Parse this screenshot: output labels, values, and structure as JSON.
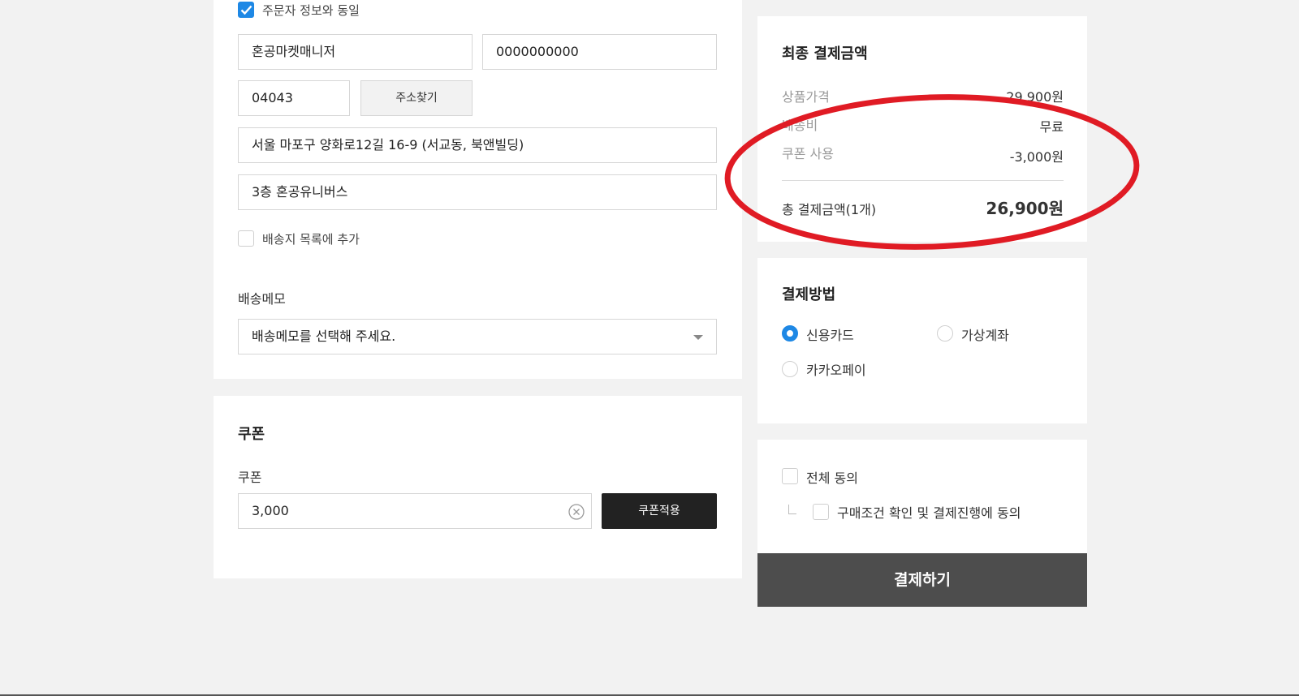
{
  "shipping": {
    "same_as_orderer_label": "주문자 정보와 동일",
    "name_value": "혼공마켓매니저",
    "phone_value": "0000000000",
    "postcode_value": "04043",
    "find_address_button": "주소찾기",
    "address_value": "서울 마포구 양화로12길 16-9 (서교동, 북앤빌딩)",
    "address_detail_value": "3층 혼공유니버스",
    "add_to_list_label": "배송지 목록에 추가",
    "memo_title": "배송메모",
    "memo_select_value": "배송메모를 선택해 주세요."
  },
  "coupon": {
    "section_title": "쿠폰",
    "field_label": "쿠폰",
    "input_value": "3,000",
    "apply_button": "쿠폰적용"
  },
  "summary": {
    "title": "최종 결제금액",
    "rows": [
      {
        "label": "상품가격",
        "value": "29,900원"
      },
      {
        "label": "배송비",
        "value": "무료"
      },
      {
        "label": "쿠폰 사용",
        "value": "-3,000원"
      }
    ],
    "total_label": "총 결제금액(1개)",
    "total_value": "26,900원"
  },
  "payment": {
    "title": "결제방법",
    "options": [
      {
        "label": "신용카드",
        "selected": true
      },
      {
        "label": "가상계좌",
        "selected": false
      },
      {
        "label": "카카오페이",
        "selected": false
      }
    ]
  },
  "agreement": {
    "all_label": "전체 동의",
    "purchase_label": "구매조건 확인 및 결제진행에 동의",
    "pay_button": "결제하기"
  },
  "colors": {
    "accent_blue": "#1e88e5",
    "annotation_red": "#e01b24",
    "pay_button_bg": "#4d4d4d"
  }
}
